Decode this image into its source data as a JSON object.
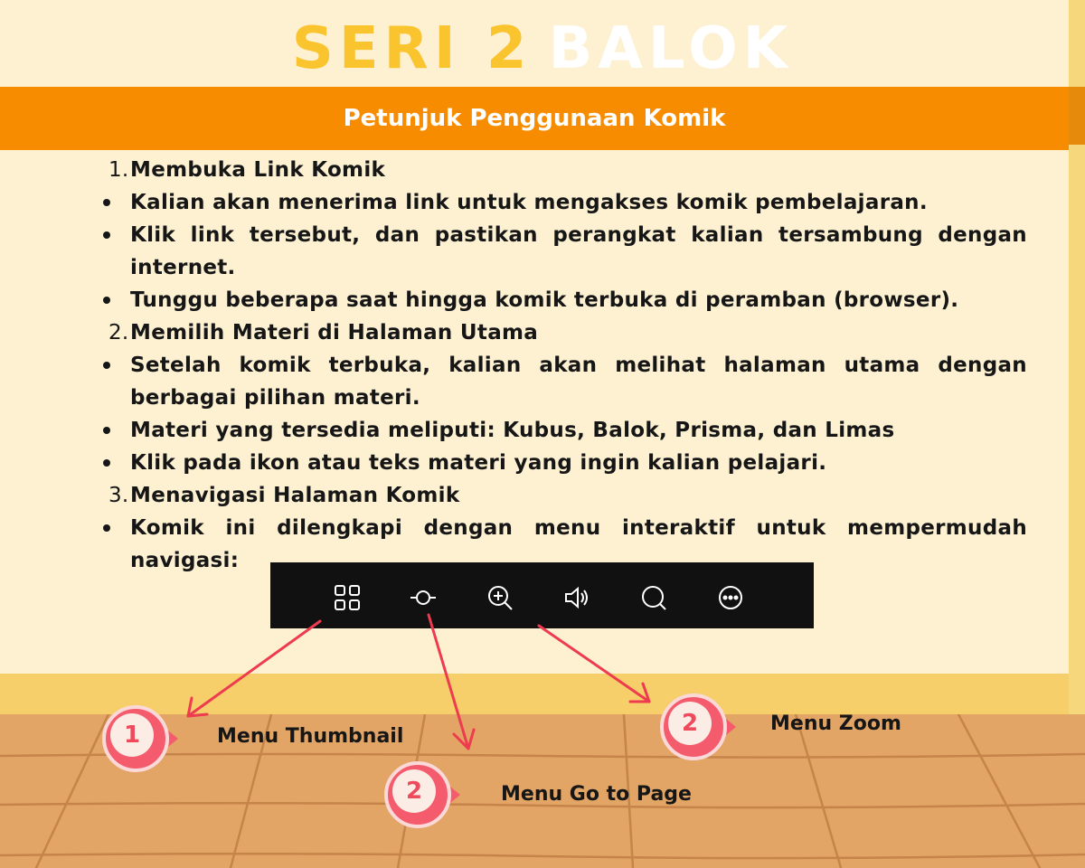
{
  "title": {
    "part1": "SERI 2",
    "part2": "BALOK"
  },
  "banner": "Petunjuk Penggunaan Komik",
  "sections": [
    {
      "num": "1.",
      "heading": "Membuka Link Komik",
      "bullets": [
        "Kalian akan menerima link untuk mengakses komik pembelajaran.",
        "Klik link tersebut, dan pastikan perangkat kalian tersambung dengan internet.",
        "Tunggu beberapa saat hingga komik terbuka di peramban (browser)."
      ]
    },
    {
      "num": "2.",
      "heading": "Memilih Materi di Halaman Utama",
      "bullets": [
        "Setelah komik terbuka, kalian akan melihat halaman utama dengan berbagai pilihan materi.",
        "Materi yang tersedia meliputi: Kubus, Balok, Prisma, dan Limas",
        "Klik pada ikon atau teks materi yang ingin kalian pelajari."
      ]
    },
    {
      "num": "3.",
      "heading": "Menavigasi Halaman Komik",
      "bullets": [
        "Komik ini dilengkapi dengan menu interaktif untuk mempermudah navigasi:"
      ]
    }
  ],
  "menubar": {
    "icons": [
      "thumbnail-grid-icon",
      "go-to-page-icon",
      "zoom-in-icon",
      "sound-icon",
      "search-icon",
      "more-icon"
    ]
  },
  "callouts": [
    {
      "number": "1",
      "label": "Menu Thumbnail"
    },
    {
      "number": "2",
      "label": "Menu Go to Page"
    },
    {
      "number": "2",
      "label": "Menu Zoom"
    }
  ],
  "colors": {
    "wall": "#fdf1d2",
    "banner": "#f78c00",
    "title_yellow": "#f9c42d",
    "marker": "#f45c6d",
    "arrow": "#ee3b4f",
    "floor": "#e2a565"
  }
}
